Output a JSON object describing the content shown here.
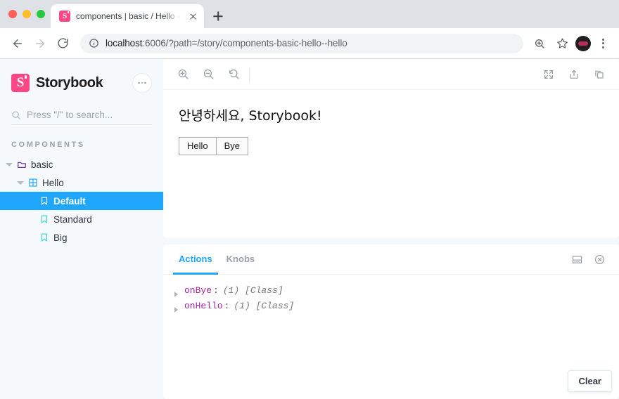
{
  "browser": {
    "tab": {
      "title": "components | basic / Hello - Hello",
      "favicon_icon": "storybook-favicon",
      "close_icon": "close-icon"
    },
    "new_tab_icon": "plus-icon",
    "nav": {
      "back_icon": "arrow-left-icon",
      "forward_icon": "arrow-right-icon",
      "reload_icon": "reload-icon"
    },
    "omnibox": {
      "info_icon": "info-circle-icon",
      "url_host": "localhost",
      "url_rest": ":6006/?path=/story/components-basic-hello--hello",
      "full_url": "localhost:6006/?path=/story/components-basic-hello--hello"
    },
    "actions": {
      "zoom_icon": "magnifier-icon",
      "bookmark_icon": "star-icon",
      "avatar_icon": "profile-avatar",
      "menu_icon": "kebab-menu-icon"
    }
  },
  "sidebar": {
    "brand": "Storybook",
    "logo_icon": "storybook-logo",
    "menu_icon": "ellipsis-icon",
    "search": {
      "icon": "search-icon",
      "placeholder": "Press \"/\" to search..."
    },
    "section_label": "COMPONENTS",
    "tree": [
      {
        "label": "basic",
        "level": 1,
        "icon": "folder-icon",
        "expanded": true,
        "selected": false
      },
      {
        "label": "Hello",
        "level": 2,
        "icon": "component-icon",
        "expanded": true,
        "selected": false
      },
      {
        "label": "Default",
        "level": 3,
        "icon": "story-icon",
        "expanded": null,
        "selected": true
      },
      {
        "label": "Standard",
        "level": 3,
        "icon": "story-icon",
        "expanded": null,
        "selected": false
      },
      {
        "label": "Big",
        "level": 3,
        "icon": "story-icon",
        "expanded": null,
        "selected": false
      }
    ]
  },
  "preview": {
    "toolbar_left": [
      {
        "name": "zoom-in-icon",
        "title": "Zoom in"
      },
      {
        "name": "zoom-out-icon",
        "title": "Zoom out"
      },
      {
        "name": "zoom-reset-icon",
        "title": "Reset zoom"
      }
    ],
    "toolbar_right": [
      {
        "name": "fullscreen-icon",
        "title": "Go full screen"
      },
      {
        "name": "open-tab-icon",
        "title": "Open canvas in new tab"
      },
      {
        "name": "copy-link-icon",
        "title": "Copy canvas link"
      }
    ],
    "story": {
      "heading": "안녕하세요, Storybook!",
      "buttons": [
        "Hello",
        "Bye"
      ]
    }
  },
  "panel": {
    "tabs": [
      {
        "label": "Actions",
        "active": true
      },
      {
        "label": "Knobs",
        "active": false
      }
    ],
    "tools": [
      {
        "name": "panel-position-icon",
        "title": "Change position"
      },
      {
        "name": "close-panel-icon",
        "title": "Close addon panel"
      }
    ],
    "logs": [
      {
        "key": "onBye",
        "value": "(1) [Class]"
      },
      {
        "key": "onHello",
        "value": "(1) [Class]"
      }
    ],
    "clear_label": "Clear"
  },
  "colors": {
    "brand_pink": "#ff4785",
    "accent_blue": "#1ea7fd",
    "sidebar_bg": "#f6f9fc",
    "folder_purple": "#6f2cac",
    "component_blue": "#1ea7fd",
    "story_teal": "#37d5d3",
    "log_key_magenta": "#a626a4"
  }
}
